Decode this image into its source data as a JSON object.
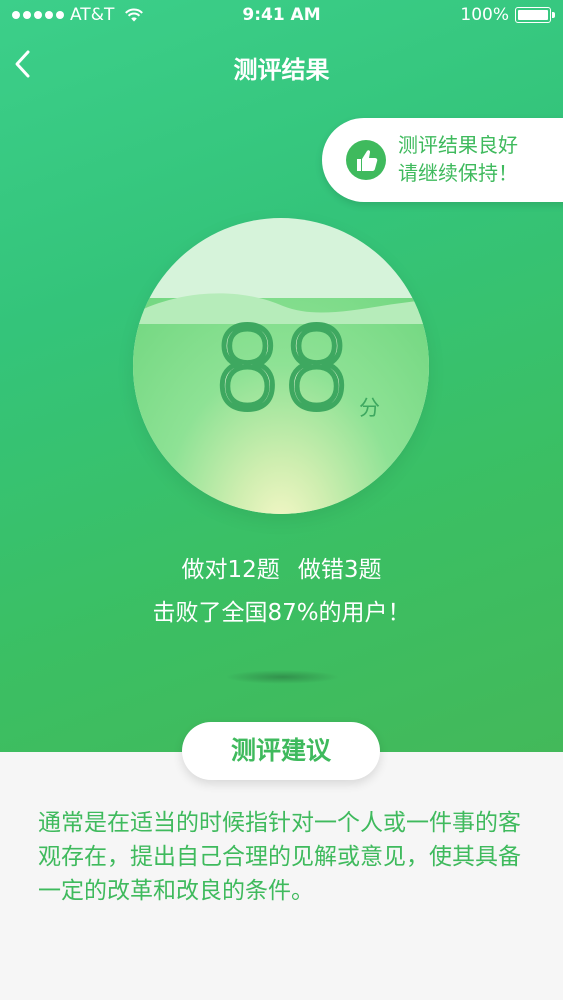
{
  "status_bar": {
    "carrier": "AT&T",
    "time": "9:41 AM",
    "battery": "100%"
  },
  "header": {
    "title": "测评结果"
  },
  "tooltip": {
    "text": "测评结果良好\n请继续保持！"
  },
  "result": {
    "score": "88",
    "unit": "分",
    "correct": "做对12题",
    "wrong": "做错3题",
    "beat": "击败了全国87%的用户！"
  },
  "advice": {
    "button_label": "测评建议",
    "text": "通常是在适当的时候指针对一个人或一件事的客观存在，提出自己合理的见解或意见，使其具备一定的改革和改良的条件。"
  },
  "colors": {
    "accent": "#3fba5d",
    "background": "#f6f6f6"
  }
}
